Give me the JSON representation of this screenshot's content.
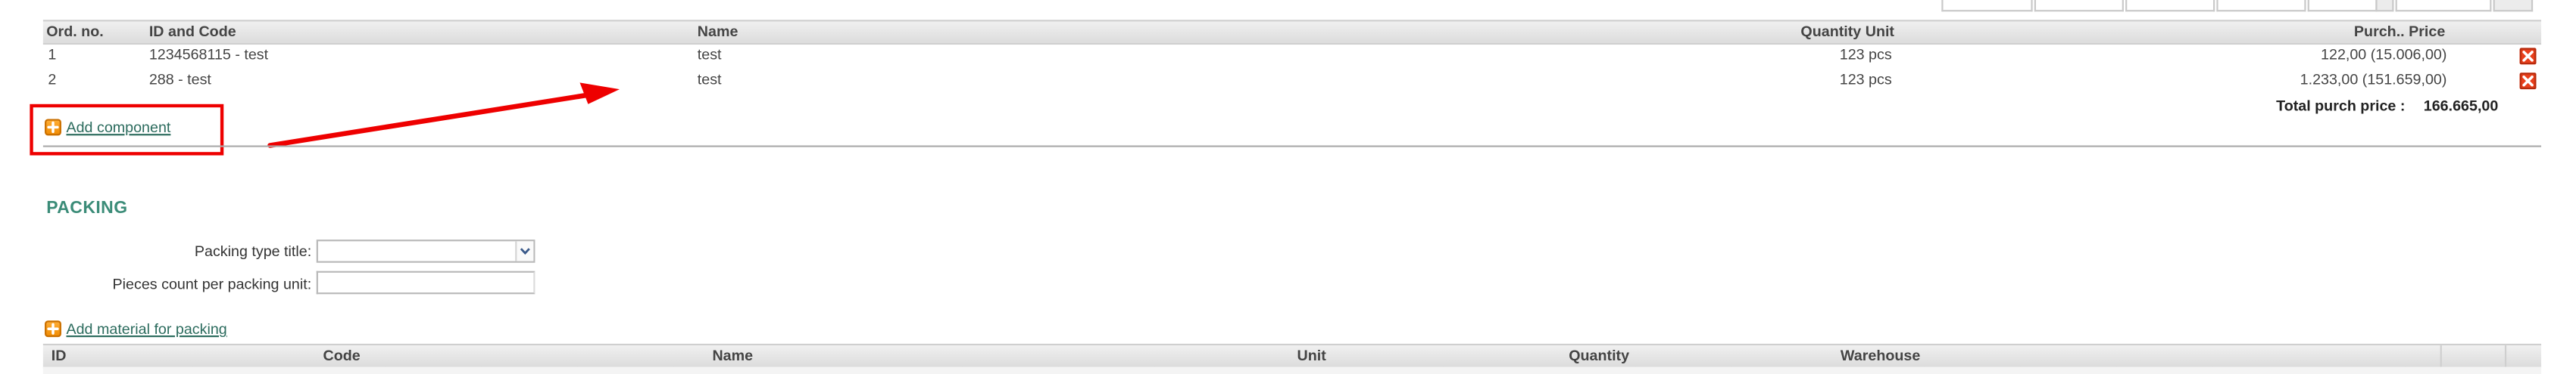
{
  "components_table": {
    "headers": {
      "ord_no": "Ord. no.",
      "id_code": "ID and Code",
      "name": "Name",
      "quantity_unit": "Quantity Unit",
      "purch_price": "Purch.. Price"
    },
    "rows": [
      {
        "ord_no": "1",
        "id_code": "1234568115 - test",
        "name": "test",
        "quantity_unit": "123 pcs",
        "purch_price": "122,00 (15.006,00)"
      },
      {
        "ord_no": "2",
        "id_code": "288 - test",
        "name": "test",
        "quantity_unit": "123 pcs",
        "purch_price": "1.233,00 (151.659,00)"
      }
    ],
    "total_label": "Total purch price :",
    "total_value": "166.665,00",
    "add_component_label": "Add component"
  },
  "packing": {
    "title": "PACKING",
    "packing_type_label": "Packing type title:",
    "packing_type_value": "",
    "pieces_count_label": "Pieces count per packing unit:",
    "pieces_count_value": "",
    "add_material_label": "Add material for packing",
    "table_headers": {
      "id": "ID",
      "code": "Code",
      "name": "Name",
      "unit": "Unit",
      "quantity": "Quantity",
      "warehouse": "Warehouse"
    }
  },
  "icons": {
    "delete": "delete-icon",
    "add": "add-icon",
    "dropdown": "chevron-down-icon"
  },
  "colors": {
    "link": "#2b6b5d",
    "section_title": "#3b8c78",
    "delete_icon": "#e8401c",
    "add_icon": "#f08a00",
    "annotation": "#ee0000"
  }
}
